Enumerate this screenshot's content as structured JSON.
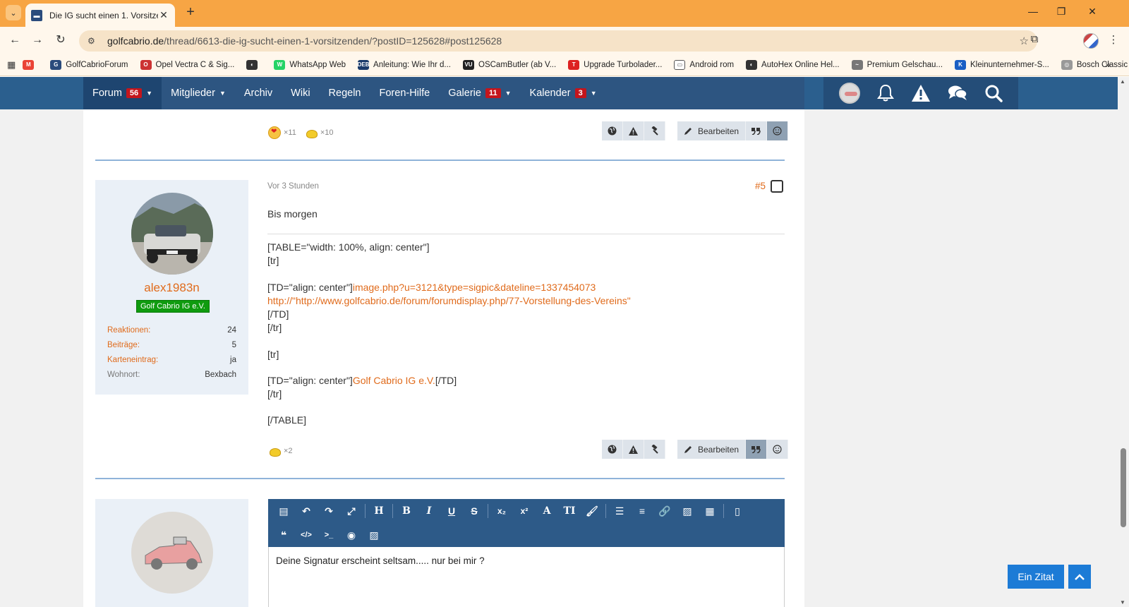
{
  "browser": {
    "tab_title": "Die IG sucht einen 1. Vorsitzend",
    "url_host": "golfcabrio.de",
    "url_path": "/thread/6613-die-ig-sucht-einen-1-vorsitzenden/?postID=125628#post125628",
    "bookmarks": [
      {
        "label": "",
        "color": "#ea4335",
        "letter": "M"
      },
      {
        "label": "GolfCabrioForum",
        "color": "#2a4b7c",
        "letter": "G"
      },
      {
        "label": "Opel Vectra C & Sig...",
        "color": "#c33",
        "letter": "O"
      },
      {
        "label": "",
        "color": "#333",
        "letter": "◐"
      },
      {
        "label": "WhatsApp Web",
        "color": "#25d366",
        "letter": "W"
      },
      {
        "label": "Anleitung: Wie Ihr d...",
        "color": "#1a3a6a",
        "letter": "DEB"
      },
      {
        "label": "OSCamButler (ab V...",
        "color": "#222",
        "letter": "VU"
      },
      {
        "label": "Upgrade Turbolader...",
        "color": "#d22",
        "letter": "T"
      },
      {
        "label": "Android rom",
        "color": "#fff",
        "letter": "▭"
      },
      {
        "label": "AutoHex Online Hel...",
        "color": "#333",
        "letter": "◐"
      },
      {
        "label": "Premium Gelschau...",
        "color": "#777",
        "letter": "~"
      },
      {
        "label": "Kleinunternehmer-S...",
        "color": "#1a5fc4",
        "letter": "K"
      },
      {
        "label": "Bosch Classic",
        "color": "#999",
        "letter": "◎"
      }
    ]
  },
  "nav": {
    "items": [
      {
        "label": "Forum",
        "badge": "56",
        "caret": true,
        "active": true
      },
      {
        "label": "Mitglieder",
        "badge": "",
        "caret": true,
        "active": false
      },
      {
        "label": "Archiv",
        "badge": "",
        "caret": false,
        "active": false
      },
      {
        "label": "Wiki",
        "badge": "",
        "caret": false,
        "active": false
      },
      {
        "label": "Regeln",
        "badge": "",
        "caret": false,
        "active": false
      },
      {
        "label": "Foren-Hilfe",
        "badge": "",
        "caret": false,
        "active": false
      },
      {
        "label": "Galerie",
        "badge": "11",
        "caret": true,
        "active": false
      },
      {
        "label": "Kalender",
        "badge": "3",
        "caret": true,
        "active": false
      }
    ]
  },
  "prev_post": {
    "reactions": [
      {
        "icon": "love-reaction-icon",
        "count": "×11"
      },
      {
        "icon": "thumbs-up-reaction-icon",
        "count": "×10"
      }
    ],
    "edit_label": "Bearbeiten"
  },
  "post5": {
    "date": "Vor 3 Stunden",
    "number": "#5",
    "username": "alex1983n",
    "user_title": "Golf Cabrio IG e.V.",
    "stats": [
      {
        "label": "Reaktionen:",
        "value": "24",
        "link": true
      },
      {
        "label": "Beiträge:",
        "value": "5",
        "link": true
      },
      {
        "label": "Karteneintrag:",
        "value": "ja",
        "link": true
      },
      {
        "label": "Wohnort:",
        "value": "Bexbach",
        "link": false
      }
    ],
    "message": "Bis morgen",
    "sig": {
      "l1": "[TABLE=\"width: 100%, align: center\"]",
      "l2": "[tr]",
      "l3a": "[TD=\"align: center\"]",
      "l3b": "image.php?u=3121&type=sigpic&dateline=1337454073",
      "l4": "http://\"http://www.golfcabrio.de/forum/forumdisplay.php/77-Vorstellung-des-Vereins\"",
      "l5": "[/TD]",
      "l6": "[/tr]",
      "l7": "[tr]",
      "l8a": "[TD=\"align: center\"]",
      "l8b": "Golf Cabrio IG e.V.",
      "l8c": "[/TD]",
      "l9": "[/tr]",
      "l10": "[/TABLE]"
    },
    "reaction_count": "×2",
    "edit_label": "Bearbeiten"
  },
  "editor": {
    "text": "Deine Signatur erscheint seltsam.....  nur bei mir ?"
  },
  "floating": {
    "quote_label": "Ein Zitat"
  },
  "colors": {
    "accent": "#e06b1c",
    "nav": "#2d5581",
    "editor": "#2d5a88",
    "badge": "#c4151c",
    "quote_button": "#1c7bd6"
  }
}
